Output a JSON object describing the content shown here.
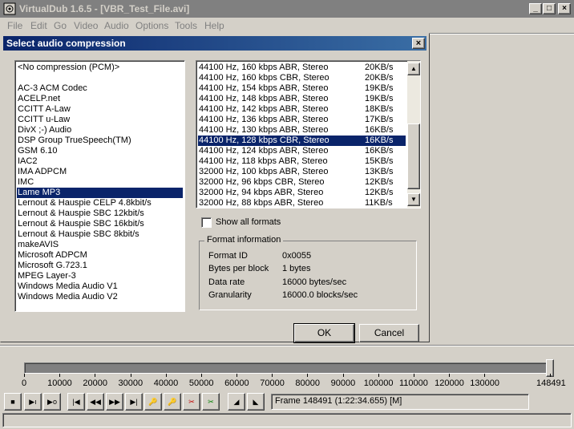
{
  "app": {
    "title": "VirtualDub 1.6.5 - [VBR_Test_File.avi]"
  },
  "menu": [
    "File",
    "Edit",
    "Go",
    "Video",
    "Audio",
    "Options",
    "Tools",
    "Help"
  ],
  "dialog": {
    "title": "Select audio compression",
    "codecs": [
      "<No compression (PCM)>",
      "",
      "AC-3 ACM Codec",
      "ACELP.net",
      "CCITT A-Law",
      "CCITT u-Law",
      "DivX ;-) Audio",
      "DSP Group TrueSpeech(TM)",
      "GSM 6.10",
      "IAC2",
      "IMA ADPCM",
      "IMC",
      "Lame MP3",
      "Lernout & Hauspie CELP 4.8kbit/s",
      "Lernout & Hauspie SBC 12kbit/s",
      "Lernout & Hauspie SBC 16kbit/s",
      "Lernout & Hauspie SBC 8kbit/s",
      "makeAVIS",
      "Microsoft ADPCM",
      "Microsoft G.723.1",
      "MPEG Layer-3",
      "Windows Media Audio V1",
      "Windows Media Audio V2"
    ],
    "selected_codec": 12,
    "formats": [
      {
        "label": "44100 Hz, 160 kbps ABR, Stereo",
        "rate": "20KB/s"
      },
      {
        "label": "44100 Hz, 160 kbps CBR, Stereo",
        "rate": "20KB/s"
      },
      {
        "label": "44100 Hz, 154 kbps ABR, Stereo",
        "rate": "19KB/s"
      },
      {
        "label": "44100 Hz, 148 kbps ABR, Stereo",
        "rate": "19KB/s"
      },
      {
        "label": "44100 Hz, 142 kbps ABR, Stereo",
        "rate": "18KB/s"
      },
      {
        "label": "44100 Hz, 136 kbps ABR, Stereo",
        "rate": "17KB/s"
      },
      {
        "label": "44100 Hz, 130 kbps ABR, Stereo",
        "rate": "16KB/s"
      },
      {
        "label": "44100 Hz, 128 kbps CBR, Stereo",
        "rate": "16KB/s"
      },
      {
        "label": "44100 Hz, 124 kbps ABR, Stereo",
        "rate": "16KB/s"
      },
      {
        "label": "44100 Hz, 118 kbps ABR, Stereo",
        "rate": "15KB/s"
      },
      {
        "label": "32000 Hz, 100 kbps ABR, Stereo",
        "rate": "13KB/s"
      },
      {
        "label": "32000 Hz, 96 kbps CBR, Stereo",
        "rate": "12KB/s"
      },
      {
        "label": "32000 Hz, 94 kbps ABR, Stereo",
        "rate": "12KB/s"
      },
      {
        "label": "32000 Hz, 88 kbps ABR, Stereo",
        "rate": "11KB/s"
      }
    ],
    "selected_format": 7,
    "show_all_formats": "Show all formats",
    "format_info": {
      "group": "Format information",
      "rows": [
        {
          "k": "Format ID",
          "v": "0x0055"
        },
        {
          "k": "Bytes per block",
          "v": "1 bytes"
        },
        {
          "k": "Data rate",
          "v": "16000 bytes/sec"
        },
        {
          "k": "Granularity",
          "v": "16000.0 blocks/sec"
        }
      ]
    },
    "ok": "OK",
    "cancel": "Cancel"
  },
  "timeline": {
    "labels": [
      "0",
      "10000",
      "20000",
      "30000",
      "40000",
      "50000",
      "60000",
      "70000",
      "80000",
      "90000",
      "100000",
      "110000",
      "120000",
      "130000"
    ],
    "end_label": "148491",
    "max": 148491
  },
  "frame_status": "Frame 148491 (1:22:34.655) [M]"
}
